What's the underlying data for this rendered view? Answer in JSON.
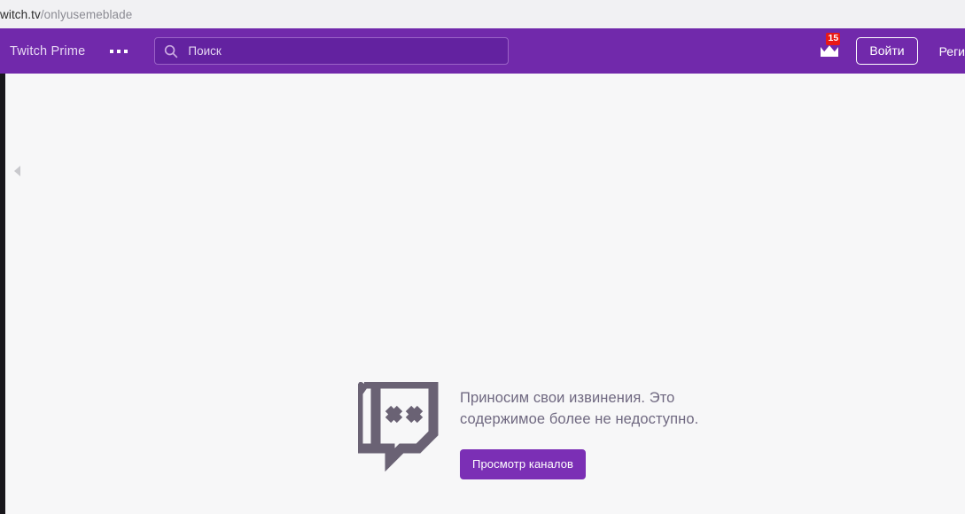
{
  "browser": {
    "url_host": "witch.tv",
    "url_path": "/onlyusemeblade"
  },
  "topnav": {
    "prime_label": "Twitch Prime",
    "more_menu_icon": "ellipsis-icon",
    "search": {
      "icon": "search-icon",
      "placeholder": "Поиск",
      "value": ""
    },
    "crown": {
      "icon": "crown-icon",
      "badge_count": "15",
      "badge_color": "#e91916"
    },
    "login_label": "Войти",
    "signup_label": "Реги",
    "background_color": "#7129ab"
  },
  "sidebar": {
    "collapse_icon": "chevron-left-icon"
  },
  "error": {
    "logo_icon": "twitch-glitch-dead-icon",
    "message": "Приносим свои извинения. Это содержимое более не недоступно.",
    "button_label": "Просмотр каналов",
    "button_color": "#7b2fb5",
    "text_color": "#6f6880"
  }
}
